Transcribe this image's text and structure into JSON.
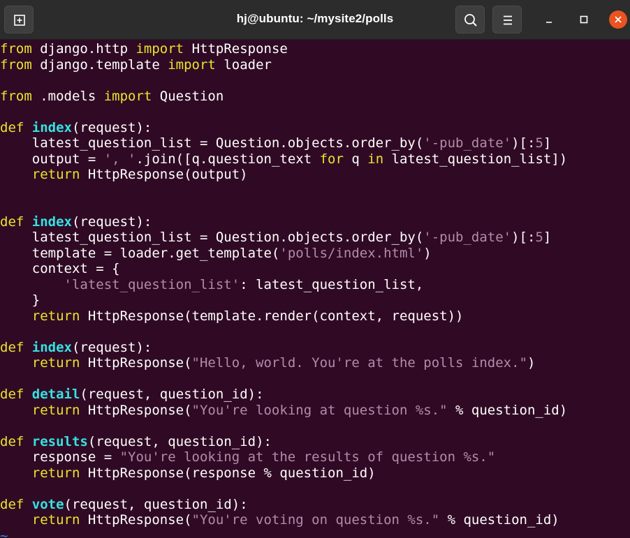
{
  "window": {
    "title": "hj@ubuntu: ~/mysite2/polls",
    "new_tab_icon": "new-tab-icon",
    "search_icon": "search-icon",
    "menu_icon": "hamburger-menu-icon",
    "minimize_icon": "minimize-icon",
    "maximize_icon": "maximize-icon",
    "close_icon": "close-icon",
    "close_color": "#e95420"
  },
  "colors": {
    "background": "#300a24",
    "keyword": "#e6e62e",
    "function_name": "#34e2e2",
    "string": "#b28ca9",
    "text": "#ffffff"
  },
  "editor": {
    "lines": [
      [
        [
          "kw",
          "from"
        ],
        [
          "t",
          " django.http "
        ],
        [
          "kw",
          "import"
        ],
        [
          "t",
          " HttpResponse"
        ]
      ],
      [
        [
          "kw",
          "from"
        ],
        [
          "t",
          " django.template "
        ],
        [
          "kw",
          "import"
        ],
        [
          "t",
          " loader"
        ]
      ],
      [],
      [
        [
          "kw",
          "from"
        ],
        [
          "t",
          " .models "
        ],
        [
          "kw",
          "import"
        ],
        [
          "t",
          " Question"
        ]
      ],
      [],
      [
        [
          "kw",
          "def"
        ],
        [
          "t",
          " "
        ],
        [
          "fn",
          "index"
        ],
        [
          "t",
          "(request):"
        ]
      ],
      [
        [
          "t",
          "    latest_question_list = Question.objects.order_by("
        ],
        [
          "str",
          "'-pub_date'"
        ],
        [
          "t",
          ")[:"
        ],
        [
          "num",
          "5"
        ],
        [
          "t",
          "]"
        ]
      ],
      [
        [
          "t",
          "    output = "
        ],
        [
          "str",
          "', '"
        ],
        [
          "t",
          ".join([q.question_text "
        ],
        [
          "kw",
          "for"
        ],
        [
          "t",
          " q "
        ],
        [
          "kw",
          "in"
        ],
        [
          "t",
          " latest_question_list])"
        ]
      ],
      [
        [
          "kw",
          "    return"
        ],
        [
          "t",
          " HttpResponse(output)"
        ]
      ],
      [],
      [],
      [
        [
          "kw",
          "def"
        ],
        [
          "t",
          " "
        ],
        [
          "fn",
          "index"
        ],
        [
          "t",
          "(request):"
        ]
      ],
      [
        [
          "t",
          "    latest_question_list = Question.objects.order_by("
        ],
        [
          "str",
          "'-pub_date'"
        ],
        [
          "t",
          ")[:"
        ],
        [
          "num",
          "5"
        ],
        [
          "t",
          "]"
        ]
      ],
      [
        [
          "t",
          "    template = loader.get_template("
        ],
        [
          "str",
          "'polls/index.html'"
        ],
        [
          "t",
          ")"
        ]
      ],
      [
        [
          "t",
          "    context = {"
        ]
      ],
      [
        [
          "t",
          "        "
        ],
        [
          "str",
          "'latest_question_list'"
        ],
        [
          "t",
          ": latest_question_list,"
        ]
      ],
      [
        [
          "t",
          "    }"
        ]
      ],
      [
        [
          "kw",
          "    return"
        ],
        [
          "t",
          " HttpResponse(template.render(context, request))"
        ]
      ],
      [],
      [
        [
          "kw",
          "def"
        ],
        [
          "t",
          " "
        ],
        [
          "fn",
          "index"
        ],
        [
          "t",
          "(request):"
        ]
      ],
      [
        [
          "kw",
          "    return"
        ],
        [
          "t",
          " HttpResponse("
        ],
        [
          "str",
          "\"Hello, world. You're at the polls index.\""
        ],
        [
          "t",
          ")"
        ]
      ],
      [],
      [
        [
          "kw",
          "def"
        ],
        [
          "t",
          " "
        ],
        [
          "fn",
          "detail"
        ],
        [
          "t",
          "(request, question_id):"
        ]
      ],
      [
        [
          "kw",
          "    return"
        ],
        [
          "t",
          " HttpResponse("
        ],
        [
          "str",
          "\"You're looking at question %s.\""
        ],
        [
          "t",
          " % question_id)"
        ]
      ],
      [],
      [
        [
          "kw",
          "def"
        ],
        [
          "t",
          " "
        ],
        [
          "fn",
          "results"
        ],
        [
          "t",
          "(request, question_id):"
        ]
      ],
      [
        [
          "t",
          "    response = "
        ],
        [
          "str",
          "\"You're looking at the results of question %s.\""
        ]
      ],
      [
        [
          "kw",
          "    return"
        ],
        [
          "t",
          " HttpResponse(response % question_id)"
        ]
      ],
      [],
      [
        [
          "kw",
          "def"
        ],
        [
          "t",
          " "
        ],
        [
          "fn",
          "vote"
        ],
        [
          "t",
          "(request, question_id):"
        ]
      ],
      [
        [
          "kw",
          "    return"
        ],
        [
          "t",
          " HttpResponse("
        ],
        [
          "str",
          "\"You're voting on question %s.\""
        ],
        [
          "t",
          " % question_id)"
        ]
      ],
      [
        [
          "tilde",
          "~"
        ]
      ]
    ]
  }
}
